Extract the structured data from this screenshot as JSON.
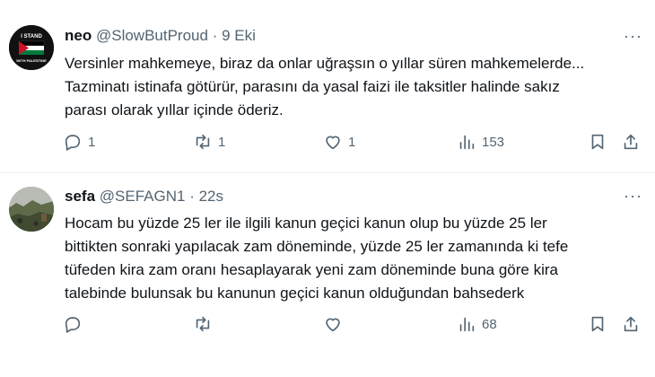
{
  "tweets": [
    {
      "name": "neo",
      "handle": "@SlowButProud",
      "dot": "·",
      "time": "9 Eki",
      "text_lines": [
        "Versinler mahkemeye, biraz da onlar uğraşsın o yıllar süren mahkemelerde...",
        "Tazminatı istinafa götürür, parasını da yasal faizi ile taksitler halinde sakız",
        "parası olarak yıllar içinde öderiz."
      ],
      "avatar_text": [
        "I STAND",
        "WITH PALESTINE"
      ],
      "replies": "1",
      "reposts": "1",
      "likes": "1",
      "views": "153"
    },
    {
      "name": "sefa",
      "handle": "@SEFAGN1",
      "dot": "·",
      "time": "22s",
      "text_lines": [
        "Hocam bu yüzde 25 ler ile ilgili kanun geçici kanun olup bu yüzde 25 ler",
        "bittikten sonraki yapılacak zam döneminde, yüzde 25 ler zamanında ki tefe",
        "tüfeden kira zam oranı hesaplayarak yeni zam döneminde buna göre kira",
        "talebinde bulunsak bu kanunun geçici kanun olduğundan bahsederk"
      ],
      "replies": "",
      "reposts": "",
      "likes": "",
      "views": "68"
    }
  ],
  "more_label": "···",
  "icons": {
    "reply": "reply-icon",
    "repost": "repost-icon",
    "like": "like-icon",
    "views": "views-icon",
    "bookmark": "bookmark-icon",
    "share": "share-icon"
  },
  "colors": {
    "text": "#0f1419",
    "secondary": "#536471",
    "divider": "#eff3f4",
    "flag_red": "#ce1126",
    "flag_green": "#007a3d"
  }
}
